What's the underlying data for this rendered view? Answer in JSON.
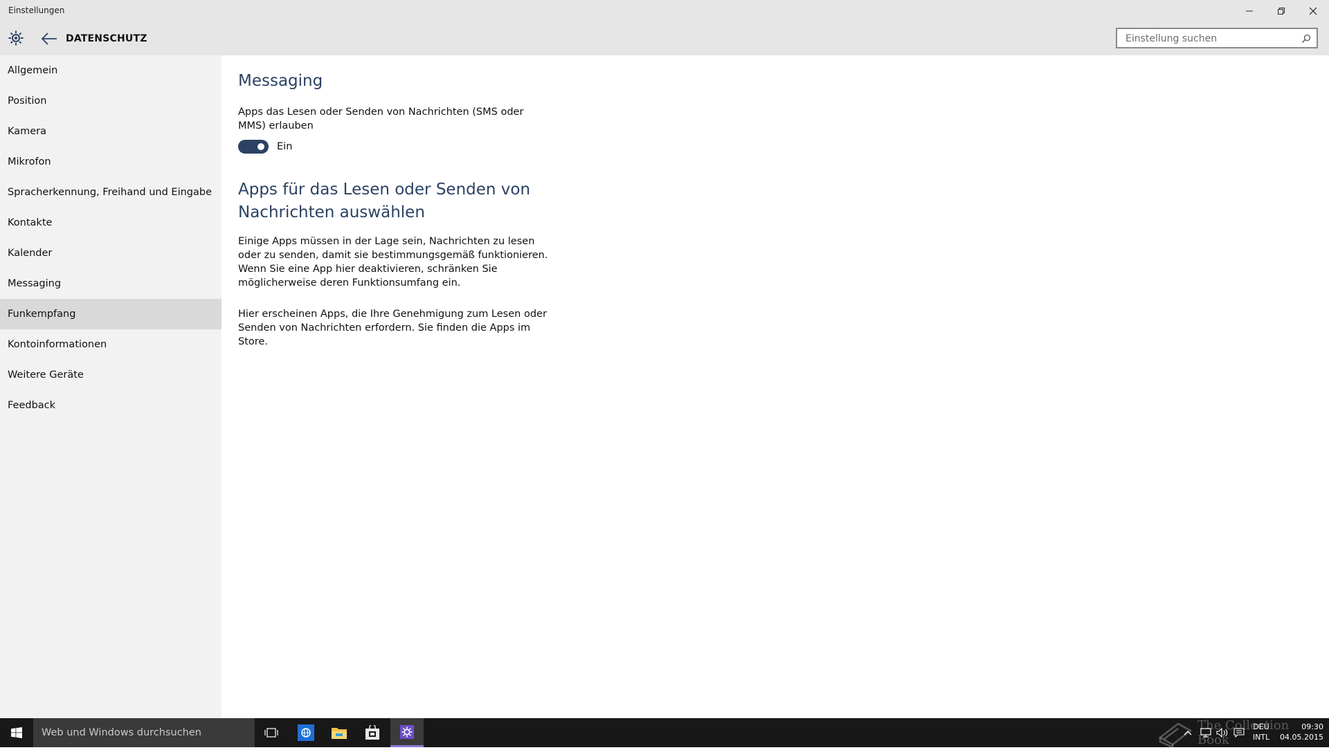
{
  "window": {
    "title": "Einstellungen",
    "controls": [
      "minimize",
      "maximize",
      "close"
    ]
  },
  "header": {
    "page_title": "DATENSCHUTZ",
    "search_placeholder": "Einstellung suchen"
  },
  "sidebar": {
    "items": [
      {
        "label": "Allgemein",
        "selected": false
      },
      {
        "label": "Position",
        "selected": false
      },
      {
        "label": "Kamera",
        "selected": false
      },
      {
        "label": "Mikrofon",
        "selected": false
      },
      {
        "label": "Spracherkennung, Freihand und Eingabe",
        "selected": false
      },
      {
        "label": "Kontakte",
        "selected": false
      },
      {
        "label": "Kalender",
        "selected": false
      },
      {
        "label": "Messaging",
        "selected": false
      },
      {
        "label": "Funkempfang",
        "selected": true
      },
      {
        "label": "Kontoinformationen",
        "selected": false
      },
      {
        "label": "Weitere Geräte",
        "selected": false
      },
      {
        "label": "Feedback",
        "selected": false
      }
    ]
  },
  "main": {
    "heading": "Messaging",
    "setting_label": "Apps das Lesen oder Senden von Nachrichten (SMS oder MMS) erlauben",
    "toggle_on": true,
    "toggle_state": "Ein",
    "subheading": "Apps für das Lesen oder Senden von Nachrichten auswählen",
    "paragraph1": "Einige Apps müssen in der Lage sein, Nachrichten zu lesen oder zu senden, damit sie bestimmungsgemäß funktionieren. Wenn Sie eine App hier deaktivieren, schränken Sie möglicherweise deren Funktionsumfang ein.",
    "paragraph2": "Hier erscheinen Apps, die Ihre Genehmigung zum Lesen oder Senden von Nachrichten erfordern. Sie finden die Apps im Store."
  },
  "taskbar": {
    "search_text": "Web und Windows durchsuchen",
    "language_line1": "DEU",
    "language_line2": "INTL",
    "time": "09:30",
    "date": "04.05.2015",
    "watermark": "The Collection Book"
  },
  "colors": {
    "accent": "#2b4263",
    "header_bg": "#e6e6e6",
    "sidebar_bg": "#f2f2f2",
    "selected_item_bg": "#d9d9d9",
    "taskbar_bg": "#181818"
  }
}
